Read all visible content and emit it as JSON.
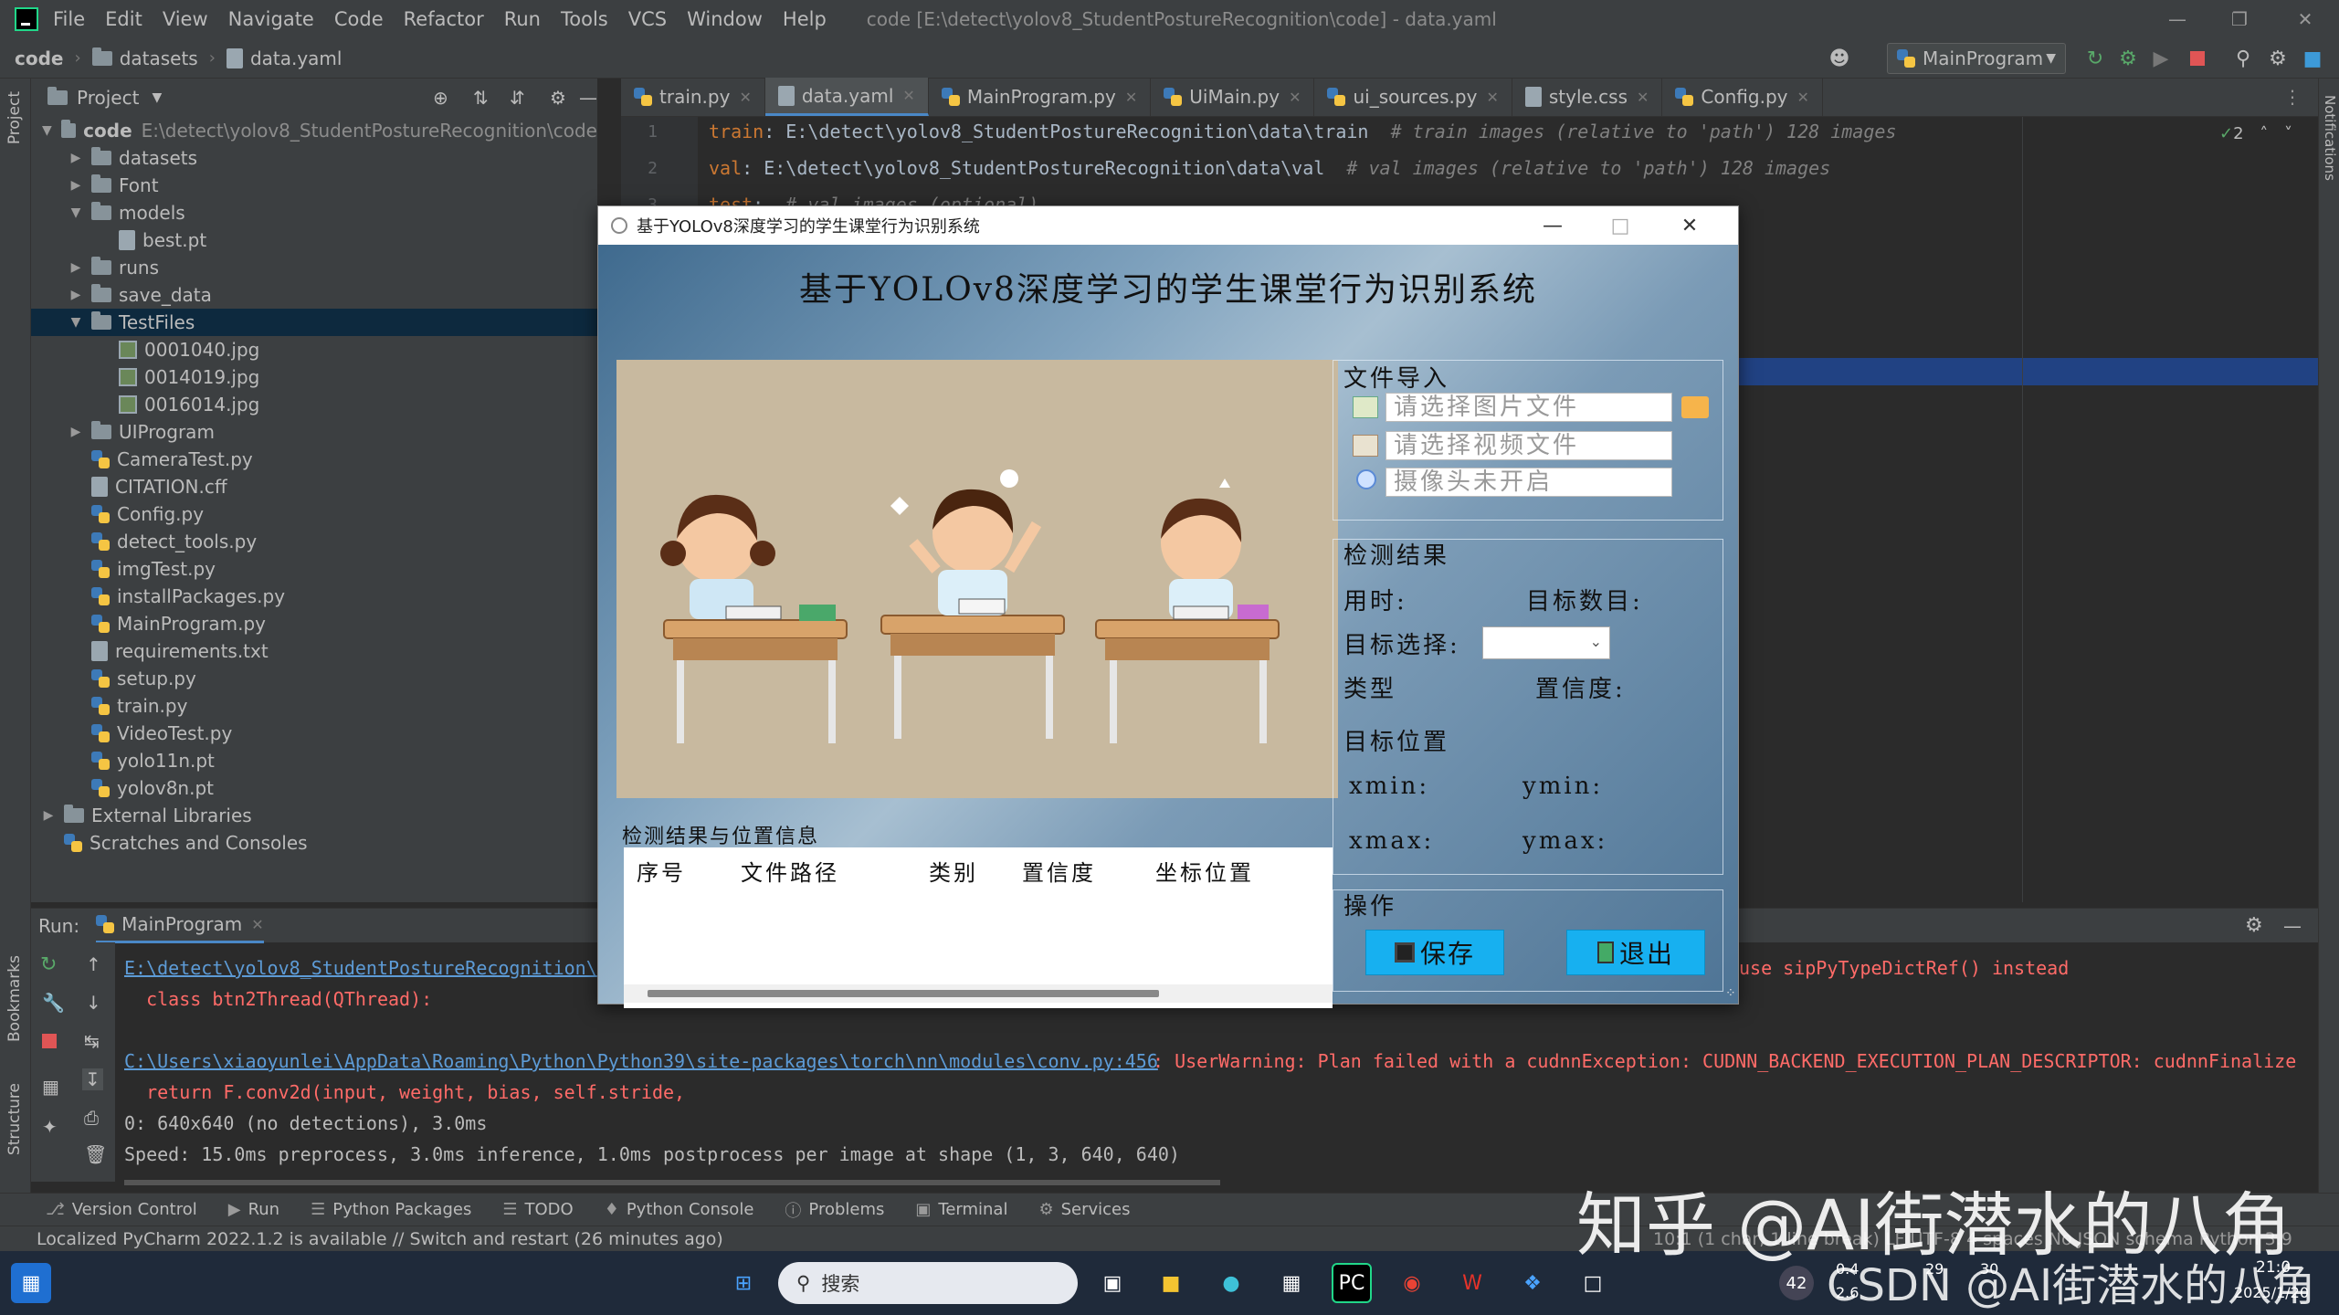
{
  "ide": {
    "menu": [
      "File",
      "Edit",
      "View",
      "Navigate",
      "Code",
      "Refactor",
      "Run",
      "Tools",
      "VCS",
      "Window",
      "Help"
    ],
    "window_title": "code [E:\\detect\\yolov8_StudentPostureRecognition\\code] - data.yaml",
    "breadcrumb": [
      "code",
      "datasets",
      "data.yaml"
    ],
    "run_config": "MainProgram",
    "project_header": "Project",
    "tree": [
      {
        "label": "code",
        "path": "E:\\detect\\yolov8_StudentPostureRecognition\\code",
        "level": 0,
        "type": "folder",
        "expanded": true
      },
      {
        "label": "datasets",
        "level": 1,
        "type": "folder"
      },
      {
        "label": "Font",
        "level": 1,
        "type": "folder"
      },
      {
        "label": "models",
        "level": 1,
        "type": "folder",
        "expanded": true
      },
      {
        "label": "best.pt",
        "level": 2,
        "type": "file"
      },
      {
        "label": "runs",
        "level": 1,
        "type": "folder"
      },
      {
        "label": "save_data",
        "level": 1,
        "type": "folder"
      },
      {
        "label": "TestFiles",
        "level": 1,
        "type": "folder",
        "expanded": true,
        "selected": true
      },
      {
        "label": "0001040.jpg",
        "level": 2,
        "type": "image"
      },
      {
        "label": "0014019.jpg",
        "level": 2,
        "type": "image"
      },
      {
        "label": "0016014.jpg",
        "level": 2,
        "type": "image"
      },
      {
        "label": "UIProgram",
        "level": 1,
        "type": "folder"
      },
      {
        "label": "CameraTest.py",
        "level": 1,
        "type": "py"
      },
      {
        "label": "CITATION.cff",
        "level": 1,
        "type": "file"
      },
      {
        "label": "Config.py",
        "level": 1,
        "type": "py"
      },
      {
        "label": "detect_tools.py",
        "level": 1,
        "type": "py"
      },
      {
        "label": "imgTest.py",
        "level": 1,
        "type": "py"
      },
      {
        "label": "installPackages.py",
        "level": 1,
        "type": "py"
      },
      {
        "label": "MainProgram.py",
        "level": 1,
        "type": "py"
      },
      {
        "label": "requirements.txt",
        "level": 1,
        "type": "file"
      },
      {
        "label": "setup.py",
        "level": 1,
        "type": "py"
      },
      {
        "label": "train.py",
        "level": 1,
        "type": "py"
      },
      {
        "label": "VideoTest.py",
        "level": 1,
        "type": "py"
      },
      {
        "label": "yolo11n.pt",
        "level": 1,
        "type": "py"
      },
      {
        "label": "yolov8n.pt",
        "level": 1,
        "type": "py"
      },
      {
        "label": "External Libraries",
        "level": 0,
        "type": "lib"
      },
      {
        "label": "Scratches and Consoles",
        "level": 0,
        "type": "scratch"
      }
    ],
    "editor_tabs": [
      {
        "label": "train.py",
        "icon": "python-icon"
      },
      {
        "label": "data.yaml",
        "icon": "yaml-icon",
        "active": true
      },
      {
        "label": "MainProgram.py",
        "icon": "python-icon"
      },
      {
        "label": "UiMain.py",
        "icon": "python-icon"
      },
      {
        "label": "ui_sources.py",
        "icon": "python-icon"
      },
      {
        "label": "style.css",
        "icon": "css-icon"
      },
      {
        "label": "Config.py",
        "icon": "python-icon"
      }
    ],
    "code_lines": [
      {
        "num": "1",
        "key": "train",
        "value": ": E:\\detect\\yolov8_StudentPostureRecognition\\data\\train  ",
        "comment": "# train images (relative to 'path') 128 images"
      },
      {
        "num": "2",
        "key": "val",
        "value": ": E:\\detect\\yolov8_StudentPostureRecognition\\data\\val  ",
        "comment": "# val images (relative to 'path') 128 images"
      },
      {
        "num": "3",
        "key": "test",
        "value": ":  ",
        "comment": "# val images (optional)"
      }
    ],
    "inspection_count": "2",
    "run_tab": "Run:",
    "run_config_tab": "MainProgram",
    "console": [
      {
        "text": "E:\\detect\\yolov8_StudentPostureRecognition\\",
        "style": "lnk"
      },
      {
        "text": "  class btn2Thread(QThread):",
        "style": "err"
      },
      {
        "text": "",
        "style": "out"
      },
      {
        "text": "C:\\Users\\xiaoyunlei\\AppData\\Roaming\\Python\\Python39\\site-packages\\torch\\nn\\modules\\conv.py:456",
        "style": "lnk"
      },
      {
        "text": "  return F.conv2d(input, weight, bias, self.stride,",
        "style": "err"
      },
      {
        "text": "0: 640x640 (no detections), 3.0ms",
        "style": "out"
      },
      {
        "text": "Speed: 15.0ms preprocess, 3.0ms inference, 1.0ms postprocess per image at shape (1, 3, 640, 640)",
        "style": "out"
      }
    ],
    "console_warning_tail": ": UserWarning: Plan failed with a cudnnException: CUDNN_BACKEND_EXECUTION_PLAN_DESCRIPTOR: cudnnFinalize",
    "console_right_fragment": "use sipPyTypeDictRef() instead",
    "bottom_tools": [
      "Version Control",
      "Run",
      "Python Packages",
      "TODO",
      "Python Console",
      "Problems",
      "Terminal",
      "Services"
    ],
    "status_text": "Localized PyCharm 2022.1.2 is available // Switch and restart (26 minutes ago)",
    "status_right": "10:1 (1 char, 1 line break)  LF  UTF-8  4 spaces  No JSON schema  Python 3.9",
    "left_strip_labels": [
      "Project",
      "Bookmarks",
      "Structure"
    ],
    "right_strip_label": "Notifications"
  },
  "app": {
    "window_title": "基于YOLOv8深度学习的学生课堂行为识别系统",
    "main_title": "基于YOLOv8深度学习的学生课堂行为识别系统",
    "file_import": {
      "title": "文件导入",
      "image_placeholder": "请选择图片文件",
      "video_placeholder": "请选择视频文件",
      "camera_status": "摄像头未开启"
    },
    "detect_result": {
      "title": "检测结果",
      "time_label": "用时:",
      "count_label": "目标数目:",
      "select_label": "目标选择:",
      "type_label": "类型",
      "conf_label": "置信度:",
      "pos_title": "目标位置",
      "xmin": "xmin:",
      "ymin": "ymin:",
      "xmax": "xmax:",
      "ymax": "ymax:"
    },
    "ops": {
      "title": "操作",
      "save": "保存",
      "exit": "退出"
    },
    "table": {
      "title": "检测结果与位置信息",
      "headers": [
        "序号",
        "文件路径",
        "类别",
        "置信度",
        "坐标位置"
      ]
    }
  },
  "taskbar": {
    "search_placeholder": "搜索",
    "weather": "42",
    "net_up": "0.4",
    "net_down": "2.6",
    "cpu": "29",
    "mem": "30",
    "clock_time": "21:0",
    "clock_date": "2025/1/20"
  },
  "watermark": {
    "main": "知乎 @AI街潜水的八角",
    "sub": "CSDN @AI街潜水的八角"
  }
}
